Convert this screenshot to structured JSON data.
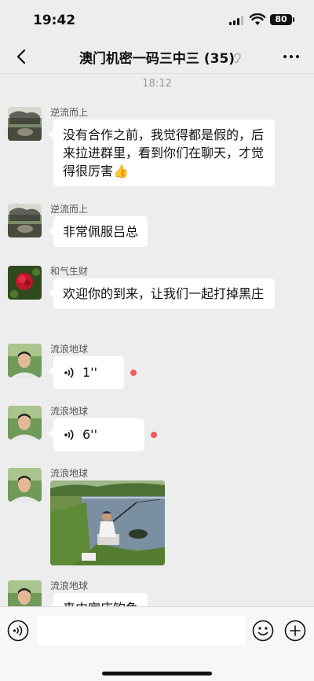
{
  "status": {
    "time": "19:42",
    "battery": "80"
  },
  "nav": {
    "title": "澳门机密一码三中三 (35)"
  },
  "chat": {
    "timestamp": "18:12",
    "messages": [
      {
        "sender": "逆流而上",
        "text": "没有合作之前，我觉得都是假的，后来拉进群里，看到你们在聊天，才觉得很厉害👍"
      },
      {
        "sender": "逆流而上",
        "text": "非常佩服吕总"
      },
      {
        "sender": "和气生财",
        "text": "欢迎你的到来，让我们一起打掉黑庄"
      },
      {
        "sender": "流浪地球",
        "voice_duration": "1''"
      },
      {
        "sender": "流浪地球",
        "voice_duration": "6''"
      },
      {
        "sender": "流浪地球",
        "type": "image"
      },
      {
        "sender": "流浪地球",
        "text": "来内宫庄钓鱼"
      }
    ]
  },
  "colors": {
    "background": "#ededed",
    "bubble": "#ffffff",
    "unread_dot": "#f25b5b"
  }
}
